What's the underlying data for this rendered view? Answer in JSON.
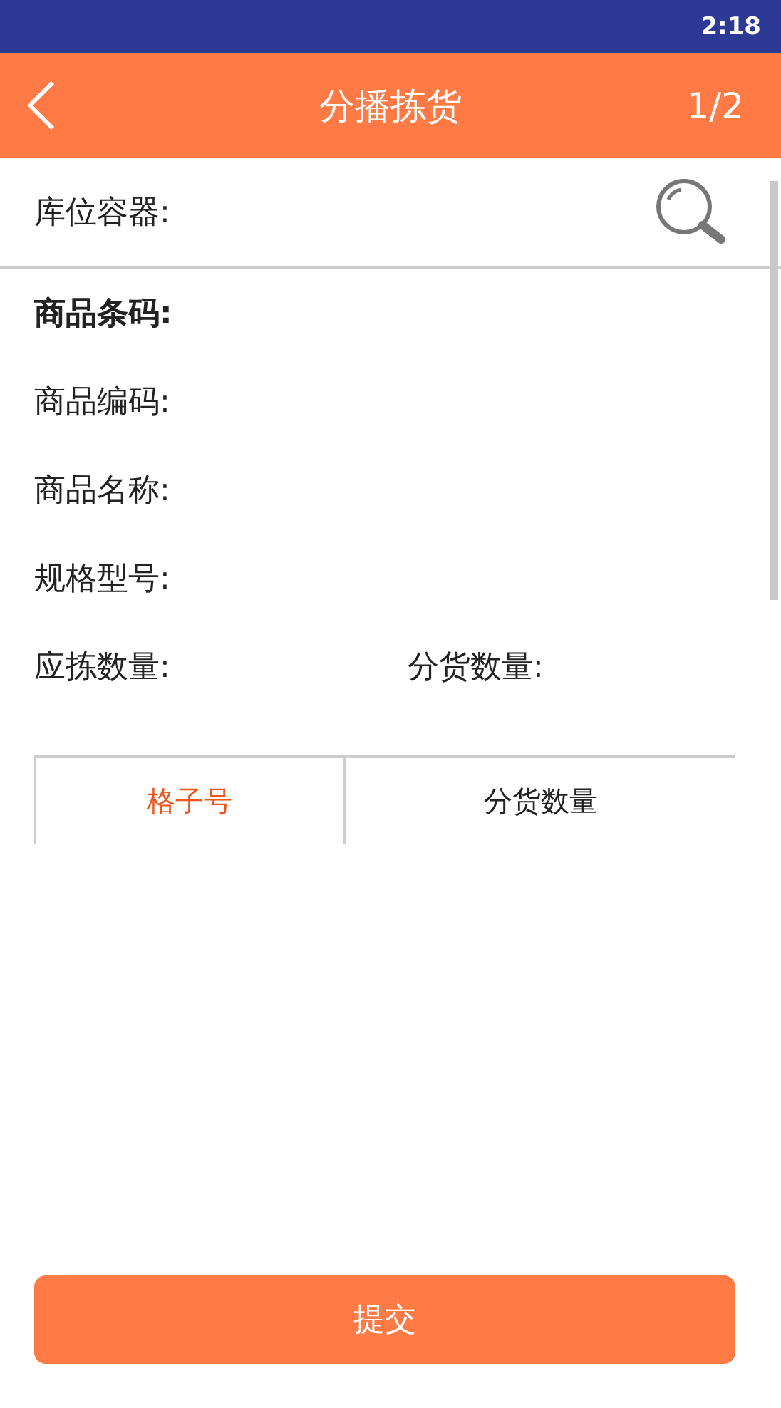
{
  "status_bar": {
    "time": "2:18"
  },
  "header": {
    "title": "分播拣货",
    "page": "1/2"
  },
  "search": {
    "label": "库位容器:"
  },
  "fields": [
    {
      "label": "商品条码:",
      "emphasized": true
    },
    {
      "label": "商品编码:",
      "emphasized": false
    },
    {
      "label": "商品名称:",
      "emphasized": false
    },
    {
      "label": "规格型号:",
      "emphasized": false
    }
  ],
  "quantities": [
    "应拣数量:",
    "分货数量:"
  ],
  "table": {
    "columns": [
      {
        "label": "格子号",
        "selected": true
      },
      {
        "label": "分货数量",
        "selected": false
      }
    ]
  },
  "submit": "提交"
}
